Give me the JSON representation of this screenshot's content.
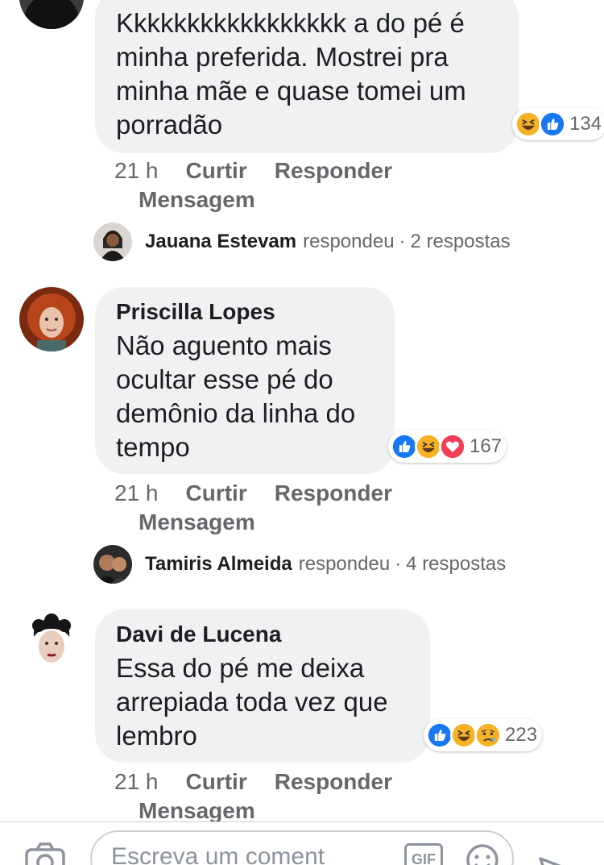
{
  "comments": [
    {
      "author": "",
      "text": "Kkkkkkkkkkkkkkkkk a do pé é minha preferida. Mostrei pra minha mãe e quase tomei um porradão",
      "reactions": [
        "haha",
        "like"
      ],
      "reaction_count": "134",
      "time": "21 h",
      "like_label": "Curtir",
      "reply_label": "Responder",
      "message_label": "Mensagem",
      "reply_preview": {
        "name": "Jauana Estevam",
        "verb": "respondeu",
        "sep": "·",
        "count": "2 respostas"
      }
    },
    {
      "author": "Priscilla Lopes",
      "text": "Não aguento mais ocultar esse pé do demônio da linha do tempo",
      "reactions": [
        "like",
        "haha",
        "love"
      ],
      "reaction_count": "167",
      "time": "21 h",
      "like_label": "Curtir",
      "reply_label": "Responder",
      "message_label": "Mensagem",
      "reply_preview": {
        "name": "Tamiris Almeida",
        "verb": "respondeu",
        "sep": "·",
        "count": "4 respostas"
      }
    },
    {
      "author": "Davi de Lucena",
      "text": "Essa do pé me deixa arrepiada toda vez que lembro",
      "reactions": [
        "like",
        "haha",
        "sad"
      ],
      "reaction_count": "223",
      "time": "21 h",
      "like_label": "Curtir",
      "reply_label": "Responder",
      "message_label": "Mensagem"
    }
  ],
  "composer": {
    "placeholder": "Escreva um coment",
    "gif_label": "GIF",
    "icons": [
      "camera-icon",
      "gif-icon",
      "emoji-icon",
      "send-icon"
    ]
  },
  "colors": {
    "like": "#1877f2",
    "love": "#f33e58",
    "haha": "#f7b125",
    "bubble": "#f0f1f3",
    "meta": "#65676b"
  }
}
